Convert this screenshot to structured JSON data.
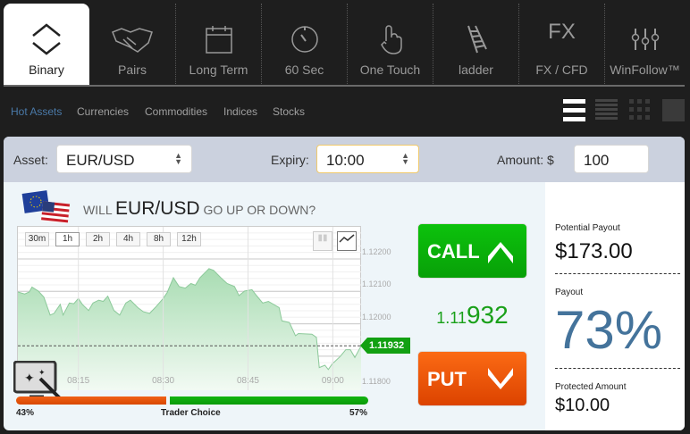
{
  "nav": {
    "tabs": [
      {
        "label": "Binary",
        "icon": "binary-arrows-icon"
      },
      {
        "label": "Pairs",
        "icon": "handshake-icon"
      },
      {
        "label": "Long Term",
        "icon": "calendar-icon"
      },
      {
        "label": "60 Sec",
        "icon": "stopwatch-icon"
      },
      {
        "label": "One Touch",
        "icon": "touch-hand-icon"
      },
      {
        "label": "ladder",
        "icon": "ladder-icon"
      },
      {
        "label": "FX / CFD",
        "icon": "fx-icon",
        "icon_text": "FX"
      },
      {
        "label": "WinFollow™",
        "icon": "sliders-icon"
      }
    ],
    "active": "Binary"
  },
  "subnav": {
    "items": [
      "Hot Assets",
      "Currencies",
      "Commodities",
      "Indices",
      "Stocks"
    ],
    "active": "Hot Assets"
  },
  "form": {
    "asset_label": "Asset:",
    "asset_value": "EUR/USD",
    "expiry_label": "Expiry:",
    "expiry_value": "10:00",
    "amount_label": "Amount: $",
    "amount_value": "100"
  },
  "question": {
    "pre": "WILL",
    "asset": "EUR/USD",
    "post": "GO UP OR DOWN?"
  },
  "timeframes": [
    "30m",
    "1h",
    "2h",
    "4h",
    "8h",
    "12h"
  ],
  "price": {
    "current": "1.11932",
    "prefix": "1.11",
    "suffix": "932"
  },
  "trade": {
    "call": "CALL",
    "put": "PUT"
  },
  "sentiment": {
    "put_pct": 43,
    "call_pct": 57,
    "put_label": "43%",
    "call_label": "57%",
    "title": "Trader Choice"
  },
  "payout": {
    "potential_label": "Potential Payout",
    "potential_value": "$173.00",
    "payout_label": "Payout",
    "payout_value": "73%",
    "protected_label": "Protected Amount",
    "protected_value": "$10.00"
  },
  "colors": {
    "call": "#0bb30b",
    "put": "#e9530f",
    "payout": "#44739b",
    "accent": "#4a79a8"
  },
  "chart_data": {
    "type": "area",
    "xlabel": "",
    "ylabel": "",
    "x_ticks": [
      {
        "m": 15,
        "label": "08:15"
      },
      {
        "m": 30,
        "label": "08:30"
      },
      {
        "m": 45,
        "label": "08:45"
      },
      {
        "m": 60,
        "label": "09:00"
      }
    ],
    "y_ticks": [
      {
        "v": 1.122,
        "label": "1.12200"
      },
      {
        "v": 1.121,
        "label": "1.12100"
      },
      {
        "v": 1.12,
        "label": "1.12000"
      },
      {
        "v": 1.118,
        "label": "1.11800"
      }
    ],
    "xlim": [
      4.3,
      65
    ],
    "ylim": [
      1.11795,
      1.12299
    ],
    "x_unit": "minutes after 08:00",
    "points": [
      [
        4.3,
        1.12098
      ],
      [
        5.5,
        1.12092
      ],
      [
        6.3,
        1.12098
      ],
      [
        6.8,
        1.12113
      ],
      [
        7.9,
        1.12101
      ],
      [
        8.9,
        1.12082
      ],
      [
        10,
        1.12027
      ],
      [
        10.7,
        1.12032
      ],
      [
        11.8,
        1.1206
      ],
      [
        12.3,
        1.12027
      ],
      [
        13.4,
        1.12064
      ],
      [
        14.2,
        1.12062
      ],
      [
        15,
        1.12078
      ],
      [
        15.7,
        1.1206
      ],
      [
        16.8,
        1.12041
      ],
      [
        17.6,
        1.12064
      ],
      [
        18.6,
        1.12073
      ],
      [
        19.4,
        1.12069
      ],
      [
        20.2,
        1.12085
      ],
      [
        21.3,
        1.12041
      ],
      [
        22.3,
        1.12027
      ],
      [
        23.4,
        1.12064
      ],
      [
        24.2,
        1.12073
      ],
      [
        25.5,
        1.1205
      ],
      [
        26.5,
        1.12037
      ],
      [
        27.6,
        1.12032
      ],
      [
        28.6,
        1.1205
      ],
      [
        30,
        1.12078
      ],
      [
        30.7,
        1.12096
      ],
      [
        31.8,
        1.12142
      ],
      [
        32.8,
        1.12115
      ],
      [
        33.9,
        1.1211
      ],
      [
        34.9,
        1.12124
      ],
      [
        35.7,
        1.12119
      ],
      [
        36.5,
        1.12142
      ],
      [
        38.1,
        1.1217
      ],
      [
        38.9,
        1.12165
      ],
      [
        40.2,
        1.12142
      ],
      [
        41.3,
        1.12124
      ],
      [
        42.6,
        1.12115
      ],
      [
        43.4,
        1.12087
      ],
      [
        44.4,
        1.12101
      ],
      [
        45.7,
        1.12105
      ],
      [
        46.5,
        1.12087
      ],
      [
        47.6,
        1.12064
      ],
      [
        48.6,
        1.12069
      ],
      [
        50.5,
        1.1205
      ],
      [
        51,
        1.12009
      ],
      [
        52.3,
        1.12004
      ],
      [
        53.4,
        1.11963
      ],
      [
        53.9,
        1.1197
      ],
      [
        56.3,
        1.11968
      ],
      [
        57.1,
        1.11958
      ],
      [
        57.6,
        1.11865
      ],
      [
        58.6,
        1.11872
      ],
      [
        59.2,
        1.11859
      ],
      [
        59.9,
        1.11876
      ],
      [
        61.3,
        1.11899
      ],
      [
        62.3,
        1.1192
      ],
      [
        63.1,
        1.1192
      ],
      [
        63.9,
        1.11896
      ],
      [
        65,
        1.11932
      ]
    ],
    "current_value": 1.11932,
    "grid": true
  }
}
